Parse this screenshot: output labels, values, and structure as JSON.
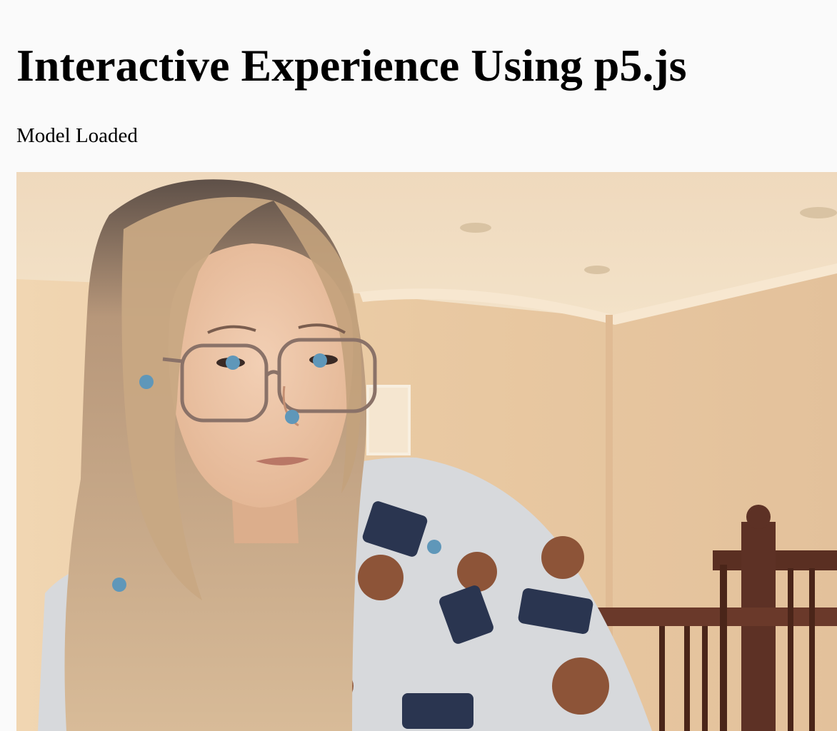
{
  "page": {
    "title": "Interactive Experience Using p5.js",
    "status": "Model Loaded"
  },
  "canvas": {
    "content": "webcam-video-frame",
    "keypoints": [
      {
        "name": "right-ear"
      },
      {
        "name": "right-eye"
      },
      {
        "name": "left-eye"
      },
      {
        "name": "nose"
      },
      {
        "name": "left-shoulder"
      },
      {
        "name": "right-shoulder"
      }
    ],
    "keypoint_color": "#5f97b9",
    "wall_color": "#e6c8a2",
    "ceiling_color": "#f0dcc0",
    "railing_color": "#5a2f22"
  }
}
